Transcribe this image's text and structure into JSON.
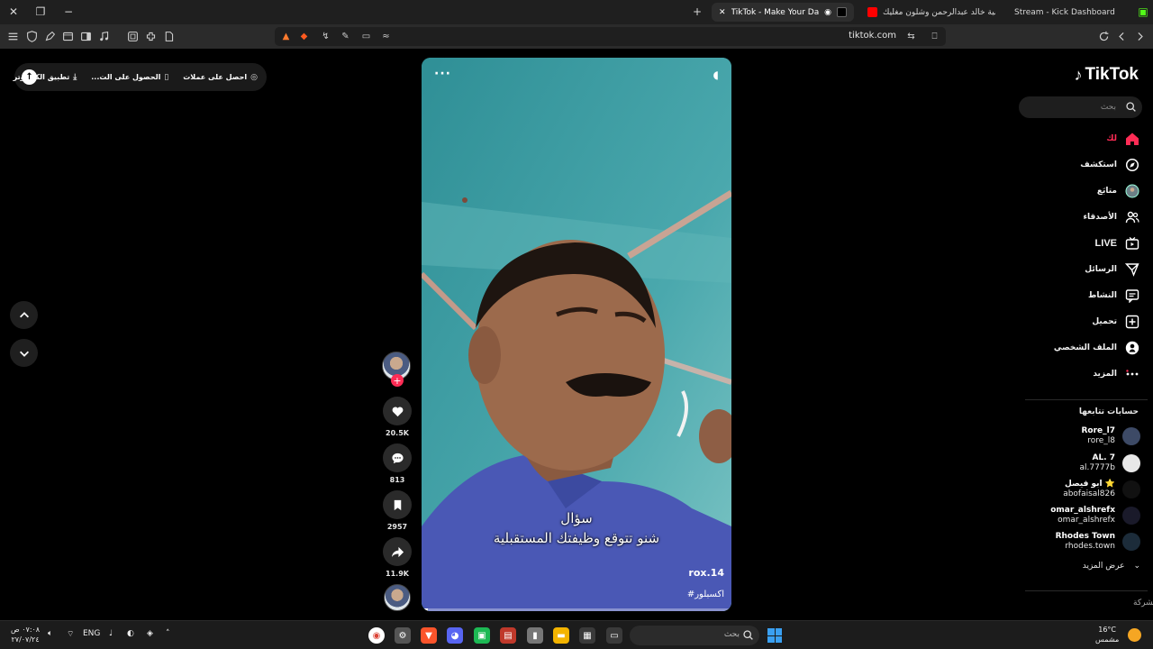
{
  "browser": {
    "tabs": [
      {
        "title": "Stream - Kick Dashboard",
        "active": false,
        "favicon_color": "#53fc18"
      },
      {
        "title": "TikTok - Make Your Day",
        "active": true,
        "favicon_color": "#000000"
      },
      {
        "title": "اغنية خالد عبدالرحمن وشلون مغليك -...",
        "active": false,
        "favicon_color": "#ff0000"
      }
    ],
    "url": "tiktok.com"
  },
  "header": {
    "get_coins": "احصل على عملات",
    "get_app": "الحصول على الت...",
    "pc_app": "تطبيق الكمبيوتر"
  },
  "sidebar": {
    "logo_text": "TikTok",
    "search_placeholder": "بحث",
    "nav": [
      {
        "label": "لك",
        "icon": "home-icon"
      },
      {
        "label": "استكشف",
        "icon": "compass-icon"
      },
      {
        "label": "متابَع",
        "icon": "following-avatar-icon"
      },
      {
        "label": "الأصدقاء",
        "icon": "friends-icon"
      },
      {
        "label": "LIVE",
        "icon": "live-icon"
      },
      {
        "label": "الرسائل",
        "icon": "send-icon"
      },
      {
        "label": "النشاط",
        "icon": "activity-icon"
      },
      {
        "label": "تحميل",
        "icon": "upload-icon"
      },
      {
        "label": "الملف الشخصي",
        "icon": "profile-icon"
      },
      {
        "label": "المزيد",
        "icon": "more-icon"
      }
    ],
    "following_title": "حسابات تتابعها",
    "accounts": [
      {
        "name": "Rore_l7",
        "handle": "rore_l8"
      },
      {
        "name": "AL. 7",
        "handle": "al.7777b"
      },
      {
        "name": "ابو فيصل ⭐",
        "handle": "abofaisal826"
      },
      {
        "name": "omar_alshrefx",
        "handle": "omar_alshrefx"
      },
      {
        "name": "Rhodes Town",
        "handle": "rhodes.town"
      }
    ],
    "see_more": "عرض المزيد",
    "company": "الشركة"
  },
  "video": {
    "caption_line1": "سؤال",
    "caption_line2": "شنو تتوقع وظيفتك المستقبلية",
    "author": "rox.14",
    "hashtag": "#اكسبلور",
    "progress": 0.02,
    "sky_color": "#3b9da3"
  },
  "actions": {
    "likes": "20.5K",
    "comments": "813",
    "saves": "2957",
    "shares": "11.9K"
  },
  "taskbar": {
    "time": "٠٧:٠٨ ص",
    "date": "٢٧/٠٧/٢٤",
    "language": "ENG",
    "search_placeholder": "بحث",
    "temperature": "16°C",
    "weather": "مشمس"
  },
  "colors": {
    "accent": "#fe2c55",
    "background": "#000000"
  }
}
